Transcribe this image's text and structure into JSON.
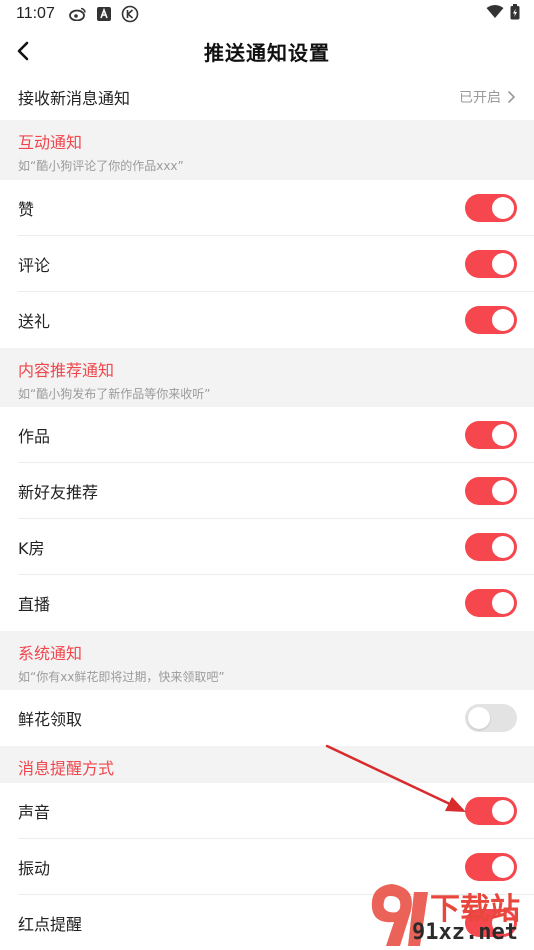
{
  "status_bar": {
    "time": "11:07",
    "icons": [
      "weibo-icon",
      "a-badge-icon",
      "k-circle-icon"
    ],
    "right_icons": [
      "wifi-icon",
      "battery-charging-icon"
    ]
  },
  "header": {
    "title": "推送通知设置",
    "back_icon": "chevron-left-icon"
  },
  "receive": {
    "label": "接收新消息通知",
    "value": "已开启"
  },
  "sections": [
    {
      "title": "互动通知",
      "subtitle": "如“酷小狗评论了你的作品xxx”",
      "items": [
        {
          "label": "赞",
          "on": true
        },
        {
          "label": "评论",
          "on": true
        },
        {
          "label": "送礼",
          "on": true
        }
      ]
    },
    {
      "title": "内容推荐通知",
      "subtitle": "如“酷小狗发布了新作品等你来收听”",
      "items": [
        {
          "label": "作品",
          "on": true
        },
        {
          "label": "新好友推荐",
          "on": true
        },
        {
          "label": "K房",
          "on": true
        },
        {
          "label": "直播",
          "on": true
        }
      ]
    },
    {
      "title": "系统通知",
      "subtitle": "如“你有xx鲜花即将过期，快来领取吧”",
      "items": [
        {
          "label": "鲜花领取",
          "on": false
        }
      ]
    },
    {
      "title": "消息提醒方式",
      "subtitle": "",
      "items": [
        {
          "label": "声音",
          "on": true
        },
        {
          "label": "振动",
          "on": true
        },
        {
          "label": "红点提醒",
          "on": true
        }
      ]
    }
  ],
  "watermark": {
    "line1": "下载站",
    "line2": "91xz.net"
  },
  "colors": {
    "accent": "#f5474d",
    "section_bg": "#f3f3f3",
    "toggle_off": "#e3e3e3",
    "annotation_arrow": "#d92b2b"
  }
}
